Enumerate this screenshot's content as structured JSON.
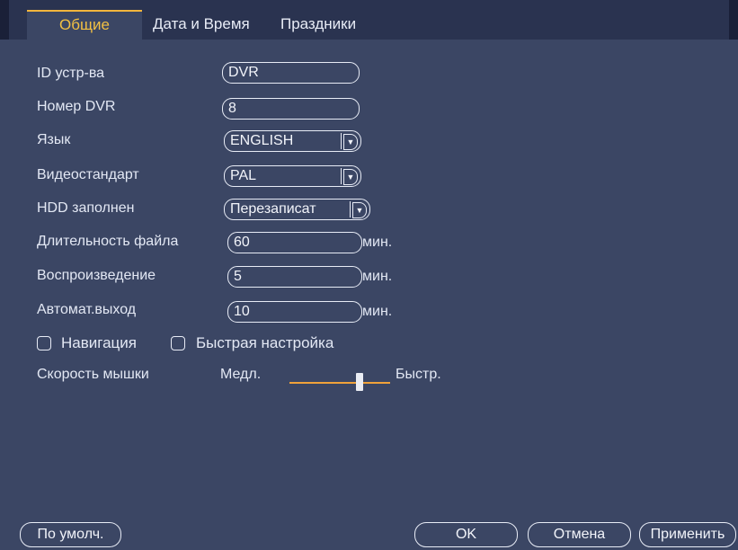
{
  "tabs": [
    {
      "label": "Общие"
    },
    {
      "label": "Дата и Время"
    },
    {
      "label": "Праздники"
    }
  ],
  "form": {
    "device_id": {
      "label": "ID устр-ва",
      "value": "DVR"
    },
    "dvr_number": {
      "label": "Номер DVR",
      "value": "8"
    },
    "language": {
      "label": "Язык",
      "value": "ENGLISH"
    },
    "video_standard": {
      "label": "Видеостандарт",
      "value": "PAL"
    },
    "hdd_full": {
      "label": "HDD заполнен",
      "value": "Перезаписат"
    },
    "file_duration": {
      "label": "Длительность файла",
      "value": "60",
      "unit": "мин."
    },
    "playback": {
      "label": "Воспроизведение",
      "value": "5",
      "unit": "мин."
    },
    "auto_logout": {
      "label": "Автомат.выход",
      "value": "10",
      "unit": "мин."
    },
    "navigation": {
      "label": "Навигация",
      "checked": false
    },
    "quick_setup": {
      "label": "Быстрая настройка",
      "checked": false
    },
    "mouse_speed": {
      "label": "Скорость мышки",
      "min_label": "Медл.",
      "max_label": "Быстр.",
      "level": 0.7
    }
  },
  "buttons": {
    "default": "По умолч.",
    "ok": "OK",
    "cancel": "Отмена",
    "apply": "Применить"
  },
  "colors": {
    "background": "#3b4664",
    "active_tab_text": "#f2c043",
    "slider": "#f0a23a"
  },
  "icons": {
    "dropdown": "chevron-down-icon"
  }
}
